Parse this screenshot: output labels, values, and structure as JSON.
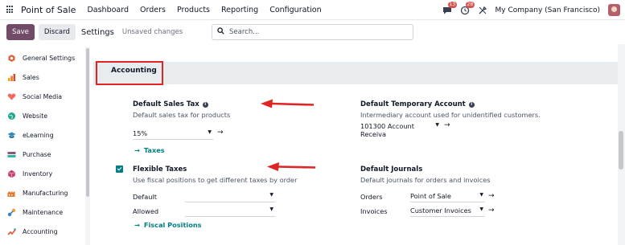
{
  "topbar": {
    "brand": "Point of Sale",
    "menu": [
      "Dashboard",
      "Orders",
      "Products",
      "Reporting",
      "Configuration"
    ],
    "messages_count": "13",
    "activity_count": "28",
    "company": "My Company (San Francisco)"
  },
  "control_panel": {
    "save_label": "Save",
    "discard_label": "Discard",
    "title": "Settings",
    "status": "Unsaved changes",
    "search_placeholder": "Search..."
  },
  "sidebar": {
    "items": [
      {
        "label": "General Settings",
        "icon": "gear-icon",
        "color": "#e0603c"
      },
      {
        "label": "Sales",
        "icon": "sales-chart-icon",
        "color": "#e6761f"
      },
      {
        "label": "Social Media",
        "icon": "heart-icon",
        "color": "#f16c5e"
      },
      {
        "label": "Website",
        "icon": "globe-icon",
        "color": "#1fa88e"
      },
      {
        "label": "eLearning",
        "icon": "graduation-icon",
        "color": "#2f8ab8"
      },
      {
        "label": "Purchase",
        "icon": "purchase-icon",
        "color": "#875a7b"
      },
      {
        "label": "Inventory",
        "icon": "box-icon",
        "color": "#c0456b"
      },
      {
        "label": "Manufacturing",
        "icon": "factory-icon",
        "color": "#e5782b"
      },
      {
        "label": "Maintenance",
        "icon": "wrench-icon",
        "color": "#3b82c4"
      },
      {
        "label": "Accounting",
        "icon": "accounting-icon",
        "color": "#e0603c"
      }
    ]
  },
  "section": {
    "title": "Accounting"
  },
  "settings": {
    "default_sales_tax": {
      "label": "Default Sales Tax",
      "description": "Default sales tax for products",
      "value": "15%",
      "link": "Taxes"
    },
    "default_temporary_account": {
      "label": "Default Temporary Account",
      "description": "Intermediary account used for unidentified customers.",
      "value": "101300 Account Receiva"
    },
    "flexible_taxes": {
      "label": "Flexible Taxes",
      "description": "Use fiscal positions to get different taxes by order",
      "checked": true,
      "row1_label": "Default",
      "row2_label": "Allowed",
      "link": "Fiscal Positions"
    },
    "default_journals": {
      "label": "Default Journals",
      "description": "Default journals for orders and invoices",
      "orders_label": "Orders",
      "orders_value": "Point of Sale",
      "invoices_label": "Invoices",
      "invoices_value": "Customer Invoices"
    }
  },
  "colors": {
    "primary": "#714b67",
    "link": "#017e84",
    "highlight": "#e02424"
  }
}
